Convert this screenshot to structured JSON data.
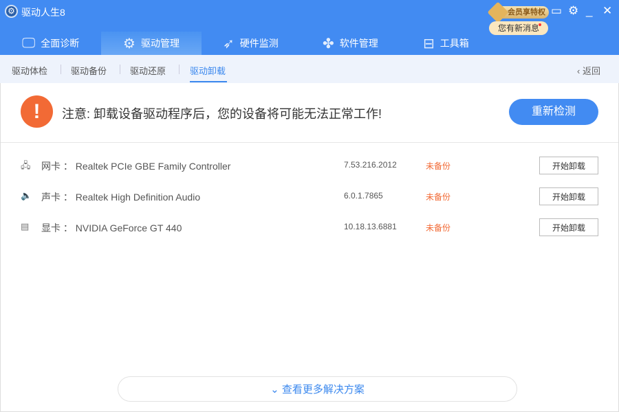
{
  "app": {
    "title": "驱动人生8"
  },
  "header": {
    "vip_label": "会员享特权",
    "message_label": "您有新消息"
  },
  "nav": [
    {
      "label": "全面诊断",
      "icon": "monitor-icon"
    },
    {
      "label": "驱动管理",
      "icon": "gear-icon"
    },
    {
      "label": "硬件监测",
      "icon": "rocket-icon"
    },
    {
      "label": "软件管理",
      "icon": "apps-icon"
    },
    {
      "label": "工具箱",
      "icon": "toolbox-icon"
    }
  ],
  "subnav": {
    "items": [
      "驱动体检",
      "驱动备份",
      "驱动还原",
      "驱动卸载"
    ],
    "back": "返回"
  },
  "notice": {
    "text": "注意: 卸载设备驱动程序后，您的设备将可能无法正常工作!",
    "rescan": "重新检测"
  },
  "drivers": [
    {
      "type": "网卡",
      "name": "Realtek PCIe GBE Family Controller",
      "version": "7.53.216.2012",
      "status": "未备份",
      "action": "开始卸载"
    },
    {
      "type": "声卡",
      "name": "Realtek High Definition Audio",
      "version": "6.0.1.7865",
      "status": "未备份",
      "action": "开始卸载"
    },
    {
      "type": "显卡",
      "name": "NVIDIA GeForce GT 440",
      "version": "10.18.13.6881",
      "status": "未备份",
      "action": "开始卸载"
    }
  ],
  "footer": {
    "more": "查看更多解决方案"
  }
}
